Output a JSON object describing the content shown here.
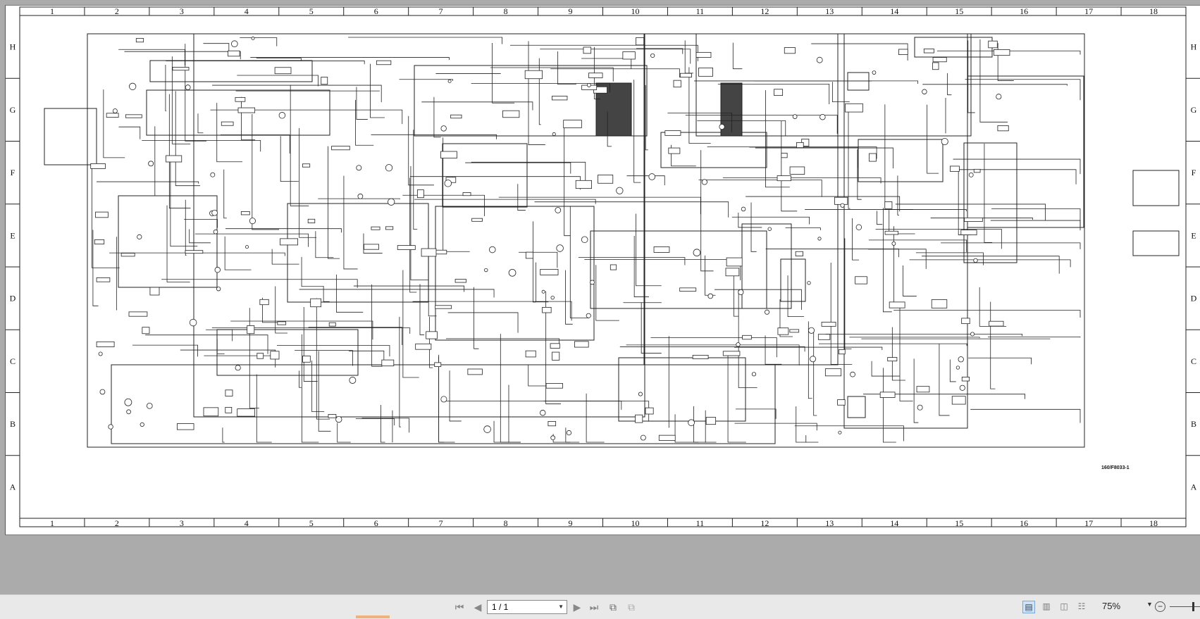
{
  "document": {
    "columns": [
      "1",
      "2",
      "3",
      "4",
      "5",
      "6",
      "7",
      "8",
      "9",
      "10",
      "11",
      "12",
      "13",
      "14",
      "15",
      "16",
      "17",
      "18"
    ],
    "rows": [
      "H",
      "G",
      "F",
      "E",
      "D",
      "C",
      "B",
      "A"
    ],
    "drawing_reference": "160/F8033-1"
  },
  "toolbar": {
    "page_value": "1 / 1",
    "zoom_label": "75%",
    "icons": {
      "first": "first-page-icon",
      "prev": "previous-page-icon",
      "next": "next-page-icon",
      "last": "last-page-icon",
      "back": "previous-view-icon",
      "forward": "next-view-icon",
      "single": "single-page-view-icon",
      "continuous": "continuous-view-icon",
      "facing": "facing-view-icon",
      "facing_cont": "facing-continuous-view-icon",
      "zoom_out": "zoom-out-icon"
    }
  },
  "colors": {
    "background": "#ababab",
    "sheet": "#ffffff",
    "ink": "#111111",
    "toolbar": "#e9e9e9",
    "active_view": "#cde3f7"
  }
}
